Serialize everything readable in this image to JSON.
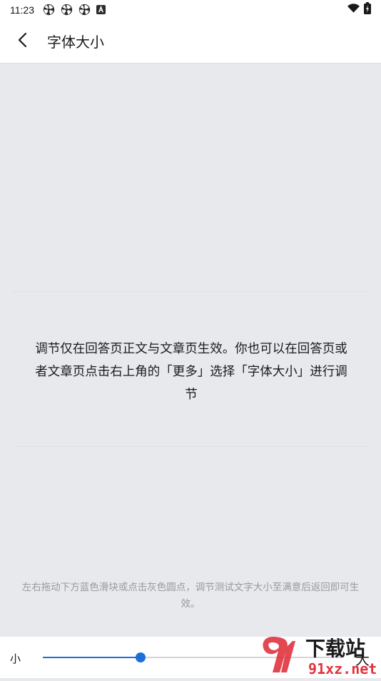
{
  "status_bar": {
    "time": "11:23",
    "notification_icons": [
      "pinwheel-icon",
      "pinwheel-icon",
      "pinwheel-icon",
      "a-badge-icon"
    ],
    "right_icons": [
      "wifi-icon",
      "battery-icon"
    ]
  },
  "header": {
    "back_icon": "chevron-left-icon",
    "title": "字体大小"
  },
  "preview": {
    "text": "调节仅在回答页正文与文章页生效。你也可以在回答页或者文章页点击右上角的「更多」选择「字体大小」进行调节"
  },
  "hint": {
    "text": "左右拖动下方蓝色滑块或点击灰色圆点，调节测试文字大小至满意后返回即可生效。"
  },
  "slider": {
    "label_small": "小",
    "label_large": "大",
    "value_fraction": 0.325
  },
  "watermark": {
    "text_main": "下载站",
    "text_url": "91xz.net"
  },
  "colors": {
    "accent": "#1a6fdb",
    "background": "#e8e9ed",
    "hint_text": "#9a9a9a",
    "watermark_red": "#e0343f"
  }
}
